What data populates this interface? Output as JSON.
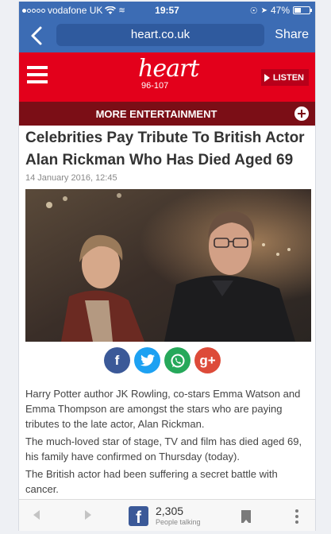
{
  "status_bar": {
    "carrier": "vodafone UK",
    "time": "19:57",
    "battery": "47%",
    "battery_level": 0.47,
    "signal_bars": 1
  },
  "browser": {
    "url": "heart.co.uk",
    "share_label": "Share"
  },
  "site_header": {
    "logo_word": "heart",
    "logo_frequency": "96-107",
    "listen_label": "LISTEN",
    "brand_color": "#e3001b"
  },
  "section_bar": {
    "label": "MORE ENTERTAINMENT",
    "color": "#7b0e16"
  },
  "article": {
    "headline": "Celebrities Pay Tribute To British Actor Alan Rickman Who Has Died Aged 69",
    "date": "14 January 2016, 12:45",
    "paragraphs": [
      "Harry Potter author JK Rowling, co-stars Emma Watson and Emma Thompson are amongst the stars who are paying tributes to the late actor, Alan Rickman.",
      "The much-loved star of stage, TV and film has died aged 69, his family have confirmed on Thursday (today).",
      "The British actor had been suffering a secret battle with cancer."
    ]
  },
  "share_buttons": [
    {
      "icon": "facebook-icon",
      "glyph": "f",
      "color": "#3b5998"
    },
    {
      "icon": "twitter-icon",
      "glyph": "t",
      "color": "#1da1f2"
    },
    {
      "icon": "whatsapp-icon",
      "glyph": "w",
      "color": "#26a85a"
    },
    {
      "icon": "google-plus-icon",
      "glyph": "g+",
      "color": "#dd4b39"
    }
  ],
  "bottom_bar": {
    "facebook_glyph": "f",
    "talking_count": "2,305",
    "talking_label": "People talking"
  }
}
